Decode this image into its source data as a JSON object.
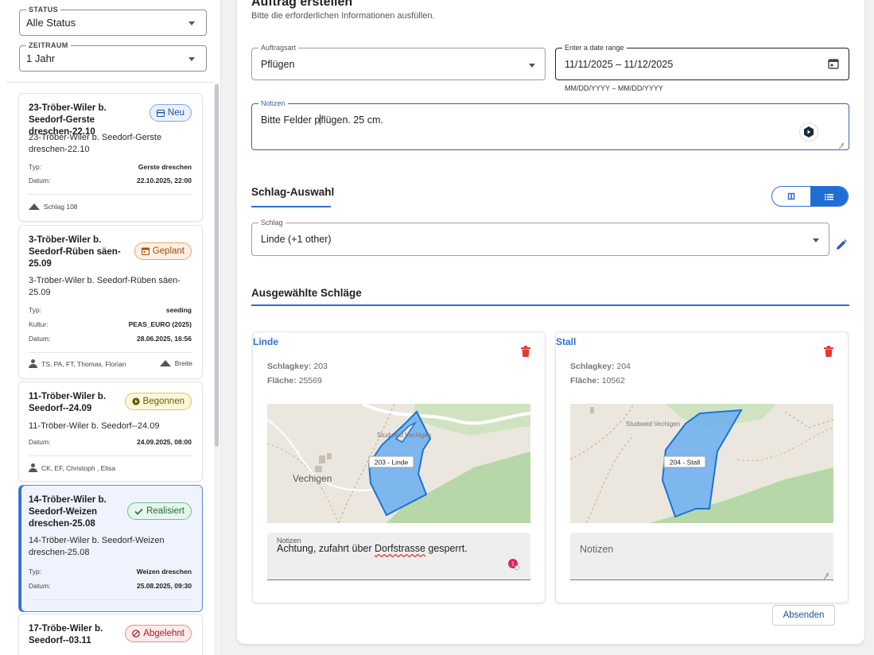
{
  "filters": {
    "status": {
      "label": "STATUS",
      "value": "Alle Status"
    },
    "period": {
      "label": "ZEITRAUM",
      "value": "1 Jahr"
    }
  },
  "cards": [
    {
      "title": "23-Tröber-Wiler b. Seedorf-Gerste dreschen-22.10",
      "badge": "Neu",
      "badge_icon": "inbox-icon",
      "subtitle": "23-Tröber-Wiler b. Seedorf-Gerste dreschen-22.10",
      "rows": [
        {
          "k": "Typ:",
          "v": "Gerste dreschen"
        },
        {
          "k": "Datum:",
          "v": "22.10.2025, 22:00"
        }
      ],
      "footer_left": "",
      "footer_right": "Schlag 108"
    },
    {
      "title": "3-Tröber-Wiler b. Seedorf-Rüben säen-25.09",
      "badge": "Geplant",
      "badge_icon": "calendar-icon",
      "subtitle": "3-Tröber-Wiler b. Seedorf-Rüben säen-25.09",
      "rows": [
        {
          "k": "Typ:",
          "v": "seeding"
        },
        {
          "k": "Kultur:",
          "v": "PEAS_EURO (2025)"
        },
        {
          "k": "Datum:",
          "v": "28.06.2025, 16:56"
        }
      ],
      "footer_left": "TS, PA, FT, Thomas, Florian",
      "footer_right": "Breite"
    },
    {
      "title": "11-Tröber-Wiler b. Seedorf--24.09",
      "badge": "Begonnen",
      "badge_icon": "play-icon",
      "subtitle": "11-Tröber-Wiler b. Seedorf--24.09",
      "rows": [
        {
          "k": "Datum:",
          "v": "24.09.2025, 08:00"
        }
      ],
      "footer_left": "CK, EF, Christoph , Elisa",
      "footer_right": ""
    },
    {
      "title": "14-Tröber-Wiler b. Seedorf-Weizen dreschen-25.08",
      "badge": "Realisiert",
      "badge_icon": "check-icon",
      "subtitle": "14-Tröber-Wiler b. Seedorf-Weizen dreschen-25.08",
      "rows": [
        {
          "k": "Typ:",
          "v": "Weizen dreschen"
        },
        {
          "k": "Datum:",
          "v": "25.08.2025, 09:30"
        }
      ],
      "footer_left": "",
      "footer_right": ""
    },
    {
      "title": "17-Tröbe-Wiler b. Seedorf--03.11",
      "badge": "Abgelehnt",
      "badge_icon": "block-icon",
      "subtitle": "",
      "rows": [],
      "footer_left": "",
      "footer_right": ""
    }
  ],
  "form": {
    "title": "Auftrag erstellen",
    "subtitle": "Bitte die erforderlichen Informationen ausfüllen.",
    "order_type": {
      "label": "Auftragsart",
      "value": "Pflügen"
    },
    "date_range": {
      "label": "Enter a date range",
      "start": "11/11/2025",
      "sep": "–",
      "end": "11/12/2025",
      "hint": "MM/DD/YYYY – MM/DD/YYYY"
    },
    "notes": {
      "label": "Notizen",
      "value_before_cursor": "Bitte Felder p",
      "value_after_cursor": "flügen. 25 cm."
    },
    "field_selection_title": "Schlag-Auswahl",
    "field_select": {
      "label": "Schlag",
      "value": "Linde (+1 other)"
    },
    "selected_title": "Ausgewählte Schläge",
    "submit_label": "Absenden"
  },
  "fields": [
    {
      "name": "Linde",
      "key_label": "Schlagkey:",
      "key": "203",
      "area_label": "Fläche:",
      "area": "25569",
      "map_label": "203 - Linde",
      "map_place": "Vechigen",
      "map_place2": "Studweid Vechigen",
      "notes_label": "Notizen",
      "notes_before": "Achtung, zufahrt über ",
      "notes_misspelled": "Dorfstrasse",
      "notes_after": " gesperrt.",
      "notes_badge": "1"
    },
    {
      "name": "Stall",
      "key_label": "Schlagkey:",
      "key": "204",
      "area_label": "Fläche:",
      "area": "10562",
      "map_label": "204 - Stall",
      "map_place2": "Studweid Vechigen",
      "notes_placeholder": "Notizen"
    }
  ],
  "colors": {
    "accent": "#2f6fd6",
    "delete": "#e53935",
    "field_fill": "#6aaef0"
  }
}
